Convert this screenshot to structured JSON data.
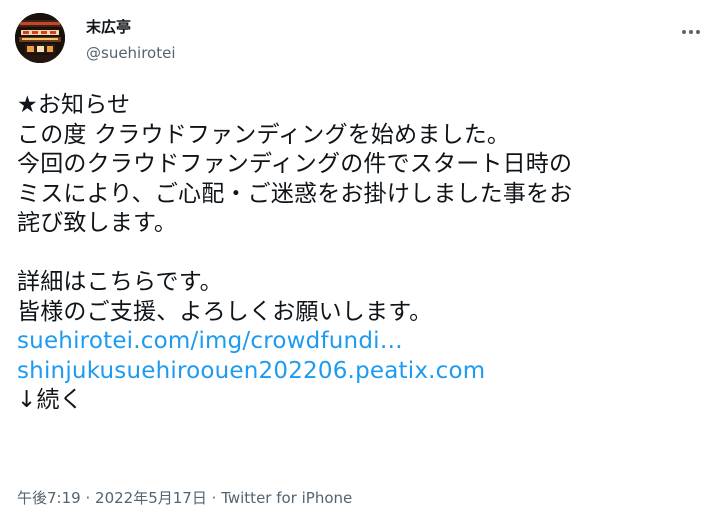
{
  "author": {
    "display_name": "末広亭",
    "handle": "@suehirotei",
    "avatar_icon": "avatar-image"
  },
  "menu_icon": "more-horizontal-icon",
  "tweet": {
    "lines": [
      "★お知らせ",
      "この度 クラウドファンディングを始めました。",
      "今回のクラウドファンディングの件でスタート日時の",
      "ミスにより、ご心配・ご迷惑をお掛けしました事をお",
      "詫び致します。",
      "",
      "詳細はこちらです。",
      "皆様のご支援、よろしくお願いします。"
    ],
    "links": [
      "suehirotei.com/img/crowdfundi…",
      "shinjukusuehiroouen202206.peatix.com"
    ],
    "tail": "↓続く"
  },
  "meta": {
    "time": "午後7:19",
    "separator": "·",
    "date": "2022年5月17日",
    "source": "Twitter for iPhone"
  },
  "colors": {
    "link": "#1d9bf0",
    "text": "#0f1419",
    "secondary": "#536471"
  }
}
